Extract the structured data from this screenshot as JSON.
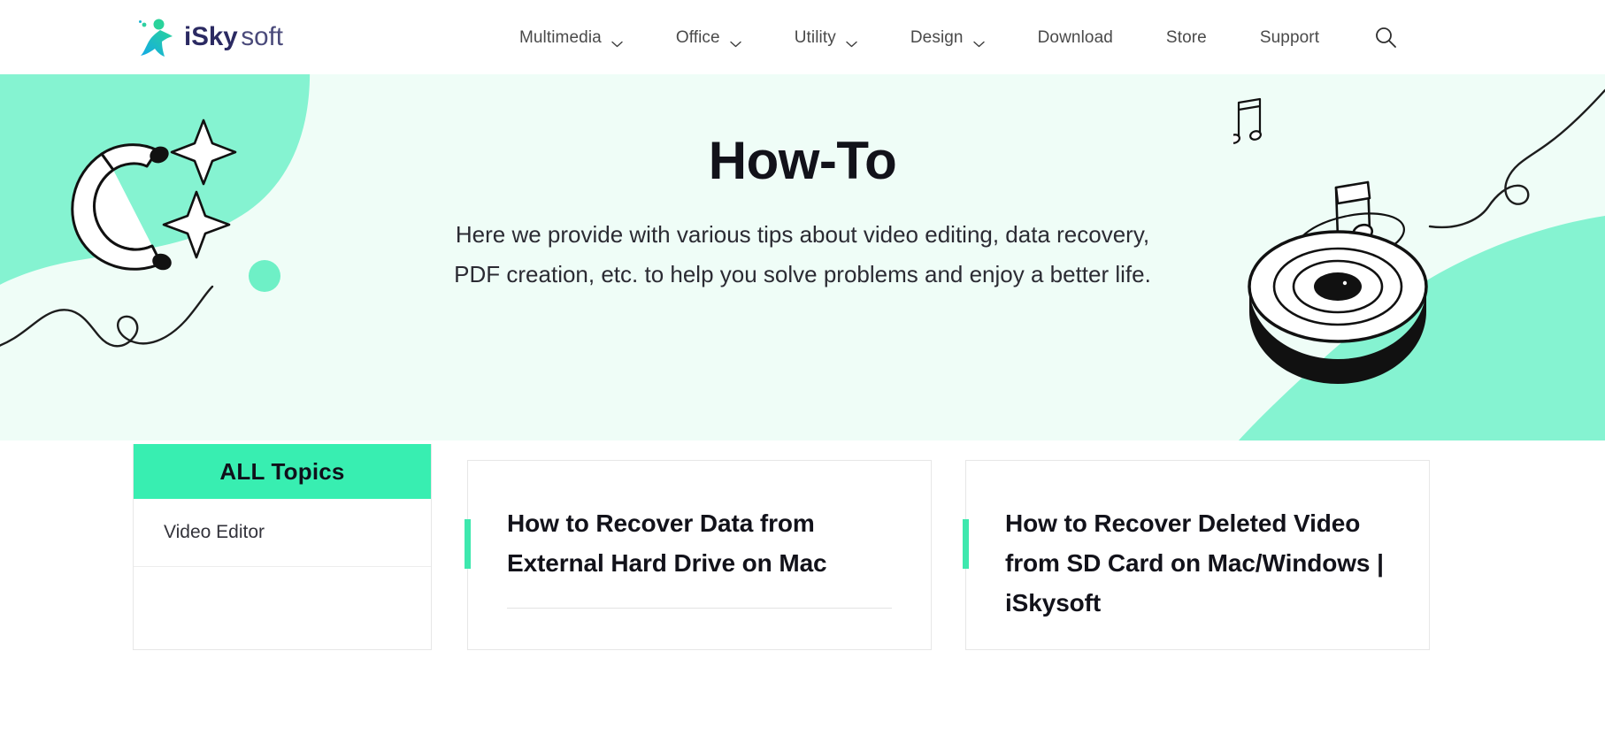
{
  "brand": {
    "name": "iSkysoft",
    "logo_icon": "iskysoft-star-logo",
    "logo_colors": [
      "#1ba5e0",
      "#1fcf8e",
      "#2b2a62"
    ]
  },
  "header": {
    "nav": [
      {
        "label": "Multimedia",
        "has_dropdown": true,
        "icon": "chevron-down-icon"
      },
      {
        "label": "Office",
        "has_dropdown": true,
        "icon": "chevron-down-icon"
      },
      {
        "label": "Utility",
        "has_dropdown": true,
        "icon": "chevron-down-icon"
      },
      {
        "label": "Design",
        "has_dropdown": true,
        "icon": "chevron-down-icon"
      },
      {
        "label": "Download",
        "has_dropdown": false,
        "icon": ""
      },
      {
        "label": "Store",
        "has_dropdown": false,
        "icon": ""
      },
      {
        "label": "Support",
        "has_dropdown": false,
        "icon": ""
      }
    ],
    "search_icon": "search-icon"
  },
  "hero": {
    "title": "How-To",
    "subtitle": "Here we provide with various tips about video editing, data recovery, PDF creation, etc. to help you solve problems and enjoy a better life.",
    "background_color": "#effdf7",
    "blob_color": "#85f3d1",
    "left_art": [
      "magnet-icon",
      "sparkle-icon",
      "sparkle-icon",
      "dot-icon",
      "squiggle-line"
    ],
    "right_art": [
      "vinyl-record-icon",
      "music-note-icon",
      "double-music-note-icon",
      "squiggle-line"
    ]
  },
  "sidebar": {
    "header_label": "ALL Topics",
    "header_color": "#38eeb1",
    "items": [
      {
        "label": "Video Editor"
      }
    ]
  },
  "cards": [
    {
      "title": "How to Recover Data from External Hard Drive on Mac",
      "accent_color": "#3ee8ae",
      "has_divider": true
    },
    {
      "title": "How to Recover Deleted Video from SD Card on Mac/Windows | iSkysoft",
      "accent_color": "#3ee8ae",
      "has_divider": false
    }
  ]
}
